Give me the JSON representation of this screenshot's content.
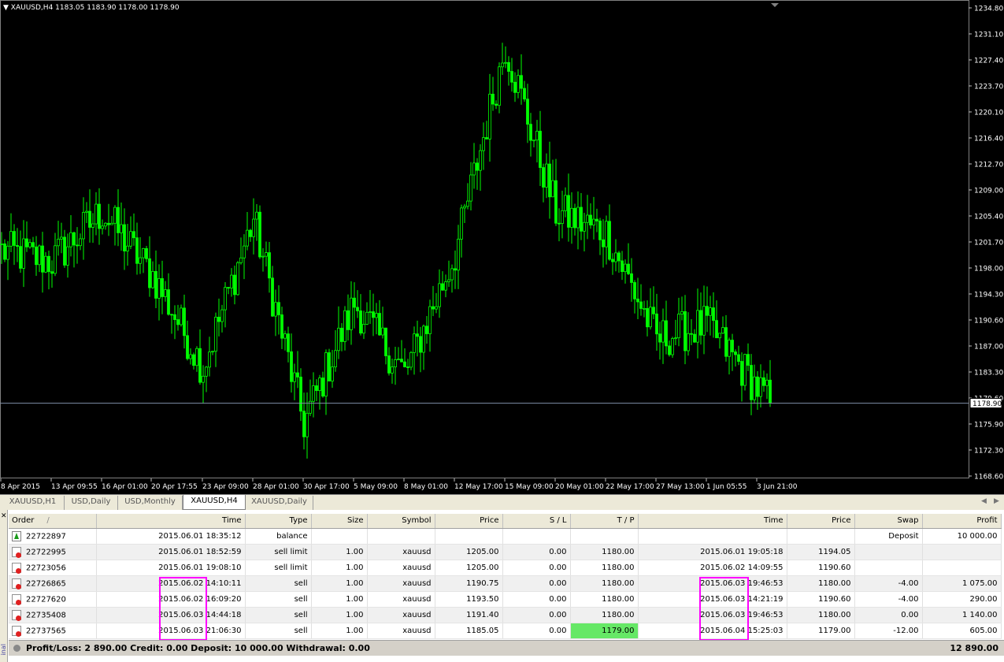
{
  "chart": {
    "title": "XAUUSD,H4  1183.05 1183.90 1178.00 1178.90",
    "current_price": "1178.90",
    "price_labels": [
      "1234.80",
      "1231.10",
      "1227.40",
      "1223.70",
      "1220.10",
      "1216.40",
      "1212.70",
      "1209.00",
      "1205.40",
      "1201.70",
      "1198.00",
      "1194.30",
      "1190.60",
      "1187.00",
      "1183.30",
      "1179.60",
      "1175.90",
      "1172.30",
      "1168.60"
    ],
    "time_labels": [
      "8 Apr 2015",
      "13 Apr 09:55",
      "16 Apr 01:00",
      "20 Apr 17:55",
      "23 Apr 09:00",
      "28 Apr 01:00",
      "30 Apr 17:00",
      "5 May 09:00",
      "8 May 01:00",
      "12 May 17:00",
      "15 May 09:00",
      "20 May 01:00",
      "22 May 17:00",
      "27 May 13:00",
      "1 Jun 05:55",
      "3 Jun 21:00"
    ],
    "candle_color": "#00ff00",
    "background": "#000000"
  },
  "chart_data": {
    "type": "line",
    "title": "XAUUSD,H4",
    "xlabel": "",
    "ylabel": "",
    "ylim": [
      1168.6,
      1234.8
    ],
    "x": [
      "8 Apr 2015",
      "13 Apr 09:55",
      "16 Apr 01:00",
      "20 Apr 17:55",
      "23 Apr 09:00",
      "28 Apr 01:00",
      "30 Apr 17:00",
      "5 May 09:00",
      "8 May 01:00",
      "12 May 17:00",
      "15 May 09:00",
      "20 May 01:00",
      "22 May 17:00",
      "27 May 13:00",
      "1 Jun 05:55",
      "3 Jun 21:00"
    ],
    "series": [
      {
        "name": "XAUUSD,H4",
        "values": [
          1200.5,
          1199.0,
          1206.0,
          1197.0,
          1184.0,
          1205.0,
          1176.0,
          1193.0,
          1183.0,
          1200.0,
          1229.5,
          1206.0,
          1203.0,
          1188.0,
          1190.0,
          1178.9
        ]
      }
    ]
  },
  "tabs": {
    "items": [
      "XAUUSD,H1",
      "USD,Daily",
      "USD,Monthly",
      "XAUUSD,H4",
      "XAUUSD,Daily"
    ],
    "active_index": 3
  },
  "terminal": {
    "side_label": "inal",
    "columns": [
      "Order",
      "/",
      "Time",
      "Type",
      "Size",
      "Symbol",
      "Price",
      "S / L",
      "T / P",
      "Time",
      "Price",
      "Swap",
      "Profit"
    ],
    "rows": [
      {
        "icon": "deposit",
        "order": "22722897",
        "time": "2015.06.01 18:35:12",
        "type": "balance",
        "size": "",
        "symbol": "",
        "price": "",
        "sl": "",
        "tp": "",
        "close_time": "",
        "close_price": "",
        "swap": "Deposit",
        "profit": "10 000.00",
        "tp_hit": false
      },
      {
        "icon": "order",
        "order": "22722995",
        "time": "2015.06.01 18:52:59",
        "type": "sell limit",
        "size": "1.00",
        "symbol": "xauusd",
        "price": "1205.00",
        "sl": "0.00",
        "tp": "1180.00",
        "close_time": "2015.06.01 19:05:18",
        "close_price": "1194.05",
        "swap": "",
        "profit": "",
        "tp_hit": false
      },
      {
        "icon": "order",
        "order": "22723056",
        "time": "2015.06.01 19:08:10",
        "type": "sell limit",
        "size": "1.00",
        "symbol": "xauusd",
        "price": "1205.00",
        "sl": "0.00",
        "tp": "1180.00",
        "close_time": "2015.06.02 14:09:55",
        "close_price": "1190.60",
        "swap": "",
        "profit": "",
        "tp_hit": false
      },
      {
        "icon": "order",
        "order": "22726865",
        "time": "2015.06.02 14:10:11",
        "type": "sell",
        "size": "1.00",
        "symbol": "xauusd",
        "price": "1190.75",
        "sl": "0.00",
        "tp": "1180.00",
        "close_time": "2015.06.03 19:46:53",
        "close_price": "1180.00",
        "swap": "-4.00",
        "profit": "1 075.00",
        "tp_hit": true
      },
      {
        "icon": "order",
        "order": "22727620",
        "time": "2015.06.02 16:09:20",
        "type": "sell",
        "size": "1.00",
        "symbol": "xauusd",
        "price": "1193.50",
        "sl": "0.00",
        "tp": "1180.00",
        "close_time": "2015.06.03 14:21:19",
        "close_price": "1190.60",
        "swap": "-4.00",
        "profit": "290.00",
        "tp_hit": false
      },
      {
        "icon": "order",
        "order": "22735408",
        "time": "2015.06.03 14:44:18",
        "type": "sell",
        "size": "1.00",
        "symbol": "xauusd",
        "price": "1191.40",
        "sl": "0.00",
        "tp": "1180.00",
        "close_time": "2015.06.03 19:46:53",
        "close_price": "1180.00",
        "swap": "0.00",
        "profit": "1 140.00",
        "tp_hit": true
      },
      {
        "icon": "order",
        "order": "22737565",
        "time": "2015.06.03 21:06:30",
        "type": "sell",
        "size": "1.00",
        "symbol": "xauusd",
        "price": "1185.05",
        "sl": "0.00",
        "tp": "1179.00",
        "close_time": "2015.06.04 15:25:03",
        "close_price": "1179.00",
        "swap": "-12.00",
        "profit": "605.00",
        "tp_hit": true
      }
    ],
    "status": {
      "text": "Profit/Loss: 2 890.00  Credit: 0.00  Deposit: 10 000.00  Withdrawal: 0.00",
      "total": "12 890.00"
    },
    "highlight_color": "#ff00ff"
  }
}
